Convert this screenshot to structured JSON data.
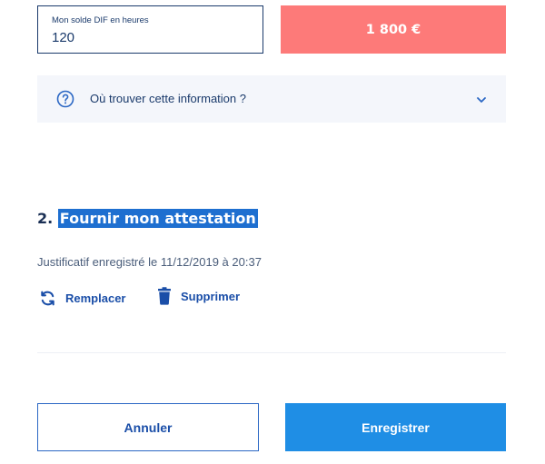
{
  "dif_field": {
    "label": "Mon solde DIF en heures",
    "value": "120"
  },
  "amount": "1 800 €",
  "info_accordion": {
    "text": "Où trouver cette information ?",
    "icon": "question-circle-icon",
    "chevron": "chevron-down-icon"
  },
  "section": {
    "number": "2.",
    "title": "Fournir mon attestation"
  },
  "saved_text": "Justificatif enregistré le 11/12/2019 à 20:37",
  "actions": {
    "replace": "Remplacer",
    "delete": "Supprimer"
  },
  "buttons": {
    "cancel": "Annuler",
    "save": "Enregistrer"
  },
  "colors": {
    "primary": "#1f8ee5",
    "navy": "#1a3a6b",
    "amount_bg": "#fd7a79",
    "highlight": "#1e6fd0"
  }
}
